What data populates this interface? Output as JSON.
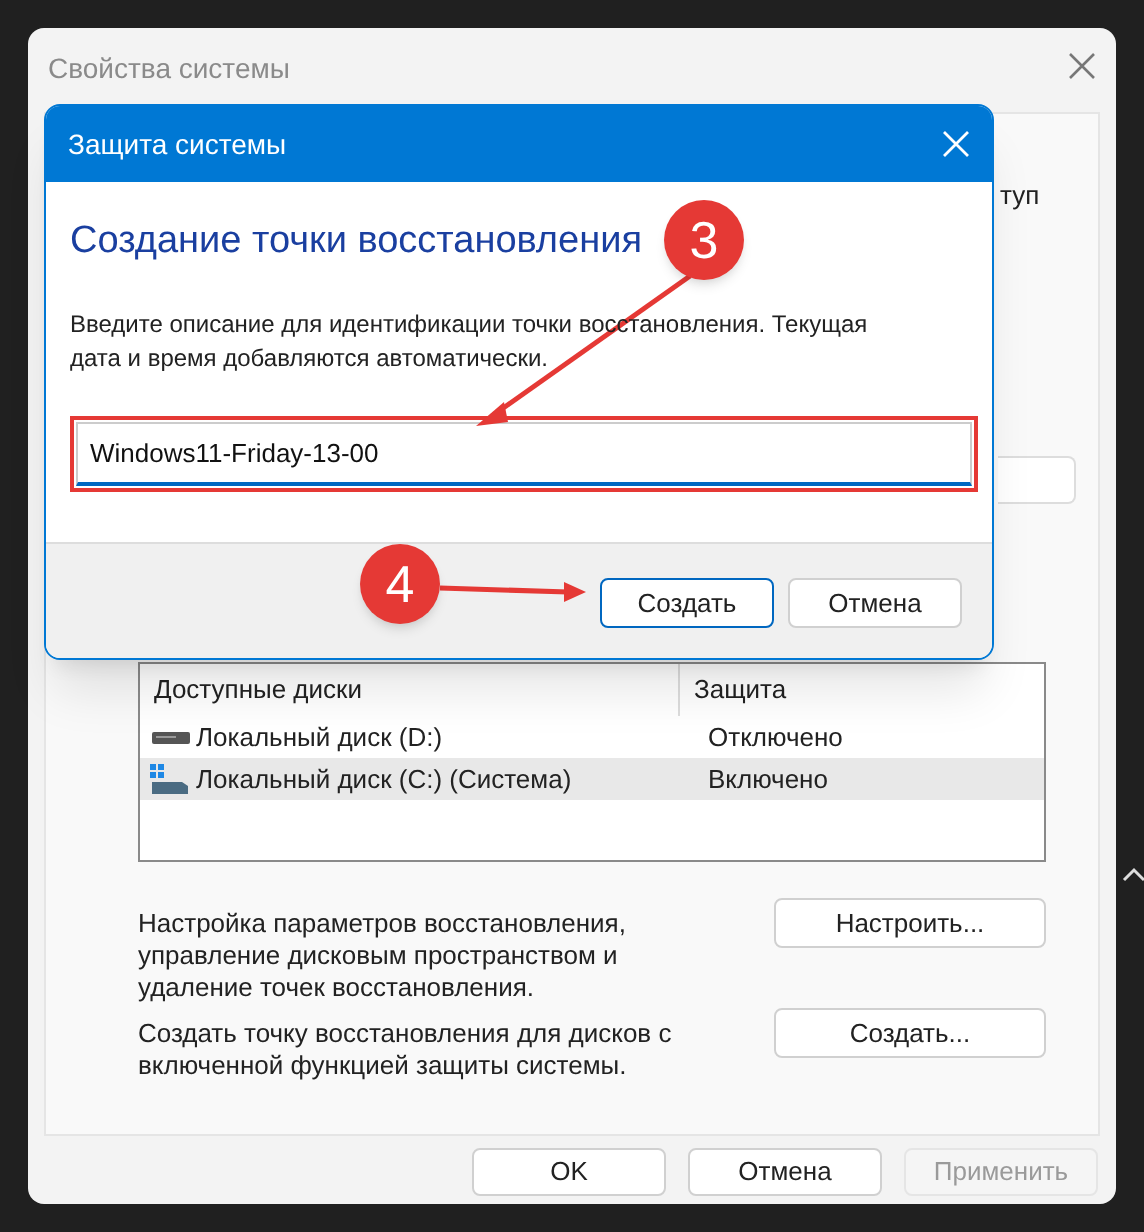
{
  "window": {
    "title": "Свойства системы",
    "behind_text": "туп"
  },
  "dialog": {
    "title": "Защита системы",
    "heading": "Создание точки восстановления",
    "description": "Введите описание для идентификации точки восстановления. Текущая дата и время добавляются автоматически.",
    "input_value": "Windows11-Friday-13-00",
    "buttons": [
      {
        "label": "Создать",
        "default": true
      },
      {
        "label": "Отмена",
        "default": false
      }
    ]
  },
  "drives": {
    "columns": [
      "Доступные диски",
      "Защита"
    ],
    "rows": [
      {
        "name": "Локальный диск (D:)",
        "protection": "Отключено",
        "system": false,
        "selected": false
      },
      {
        "name": "Локальный диск (C:) (Система)",
        "protection": "Включено",
        "system": true,
        "selected": true
      }
    ]
  },
  "actions": [
    {
      "text": "Настройка параметров восстановления, управление дисковым пространством и удаление точек восстановления.",
      "button": "Настроить..."
    },
    {
      "text": "Создать точку восстановления для дисков с включенной функцией защиты системы.",
      "button": "Создать..."
    }
  ],
  "footer_buttons": [
    {
      "label": "OK",
      "disabled": false
    },
    {
      "label": "Отмена",
      "disabled": false
    },
    {
      "label": "Применить",
      "disabled": true
    }
  ],
  "annotations": [
    {
      "label": "3"
    },
    {
      "label": "4"
    }
  ]
}
